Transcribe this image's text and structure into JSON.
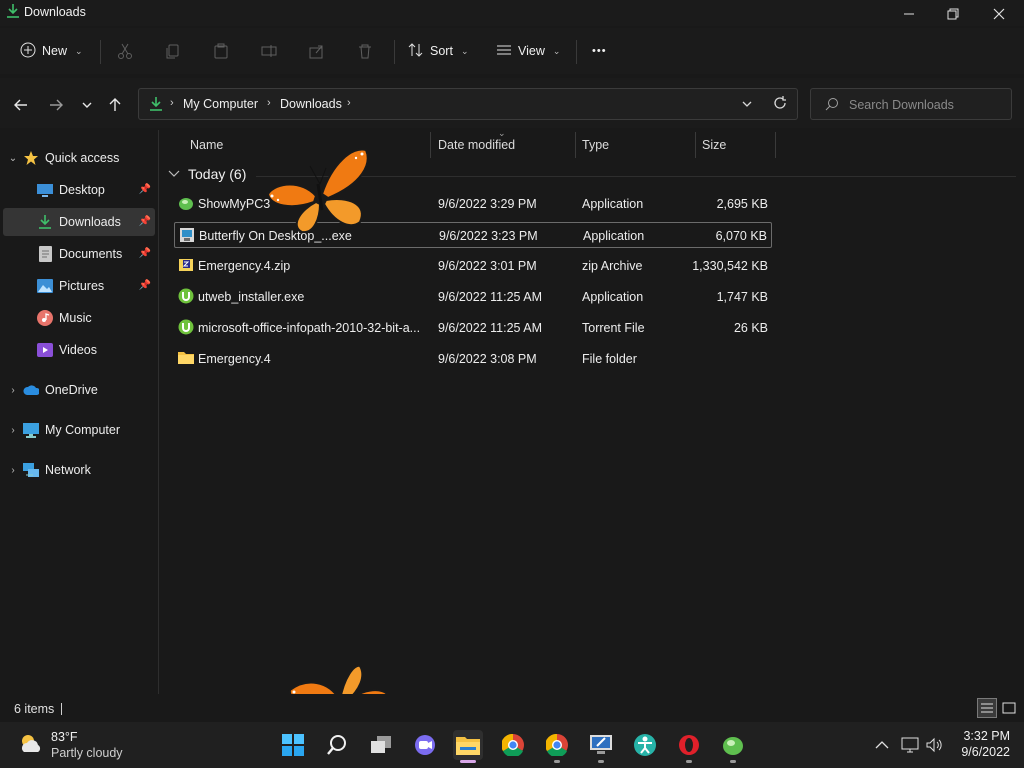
{
  "window": {
    "title": "Downloads"
  },
  "toolbar": {
    "new_label": "New",
    "sort_label": "Sort",
    "view_label": "View",
    "more_label": "•••"
  },
  "address": {
    "path": [
      "My Computer",
      "Downloads"
    ],
    "search_placeholder": "Search Downloads"
  },
  "sidebar": {
    "items": [
      {
        "label": "Quick access",
        "icon": "star-icon",
        "pinned": false
      },
      {
        "label": "Desktop",
        "icon": "desktop-icon",
        "pinned": true
      },
      {
        "label": "Downloads",
        "icon": "download-icon",
        "pinned": true,
        "selected": true
      },
      {
        "label": "Documents",
        "icon": "document-icon",
        "pinned": true
      },
      {
        "label": "Pictures",
        "icon": "pictures-icon",
        "pinned": true
      },
      {
        "label": "Music",
        "icon": "music-icon",
        "pinned": false
      },
      {
        "label": "Videos",
        "icon": "videos-icon",
        "pinned": false
      },
      {
        "label": "OneDrive",
        "icon": "onedrive-icon",
        "pinned": false
      },
      {
        "label": "My Computer",
        "icon": "computer-icon",
        "pinned": false
      },
      {
        "label": "Network",
        "icon": "network-icon",
        "pinned": false
      }
    ]
  },
  "columns": {
    "name": "Name",
    "date": "Date modified",
    "type": "Type",
    "size": "Size"
  },
  "group": {
    "label": "Today (6)"
  },
  "files": [
    {
      "name": "ShowMyPC3",
      "date": "9/6/2022 3:29 PM",
      "type": "Application",
      "size": "2,695 KB",
      "icon": "showmypc-app-icon"
    },
    {
      "name": "Butterfly On Desktop_...exe",
      "date": "9/6/2022 3:23 PM",
      "type": "Application",
      "size": "6,070 KB",
      "icon": "installer-app-icon"
    },
    {
      "name": "Emergency.4.zip",
      "date": "9/6/2022 3:01 PM",
      "type": "zip Archive",
      "size": "1,330,542 KB",
      "icon": "zip-archive-icon"
    },
    {
      "name": "utweb_installer.exe",
      "date": "9/6/2022 11:25 AM",
      "type": "Application",
      "size": "1,747 KB",
      "icon": "utorrent-icon"
    },
    {
      "name": "microsoft-office-infopath-2010-32-bit-a...",
      "date": "9/6/2022 11:25 AM",
      "type": "Torrent File",
      "size": "26 KB",
      "icon": "torrent-file-icon"
    },
    {
      "name": "Emergency.4",
      "date": "9/6/2022 3:08 PM",
      "type": "File folder",
      "size": "",
      "icon": "folder-icon"
    }
  ],
  "status": {
    "item_count": "6 items"
  },
  "taskbar": {
    "weather_temp": "83°F",
    "weather_desc": "Partly cloudy",
    "time": "3:32 PM",
    "date": "9/6/2022"
  },
  "colors": {
    "background": "#191919",
    "selected": "#353535",
    "accent_green": "#3fbf6a",
    "folder_yellow": "#f5c243",
    "butterfly_orange": "#f07a12"
  }
}
